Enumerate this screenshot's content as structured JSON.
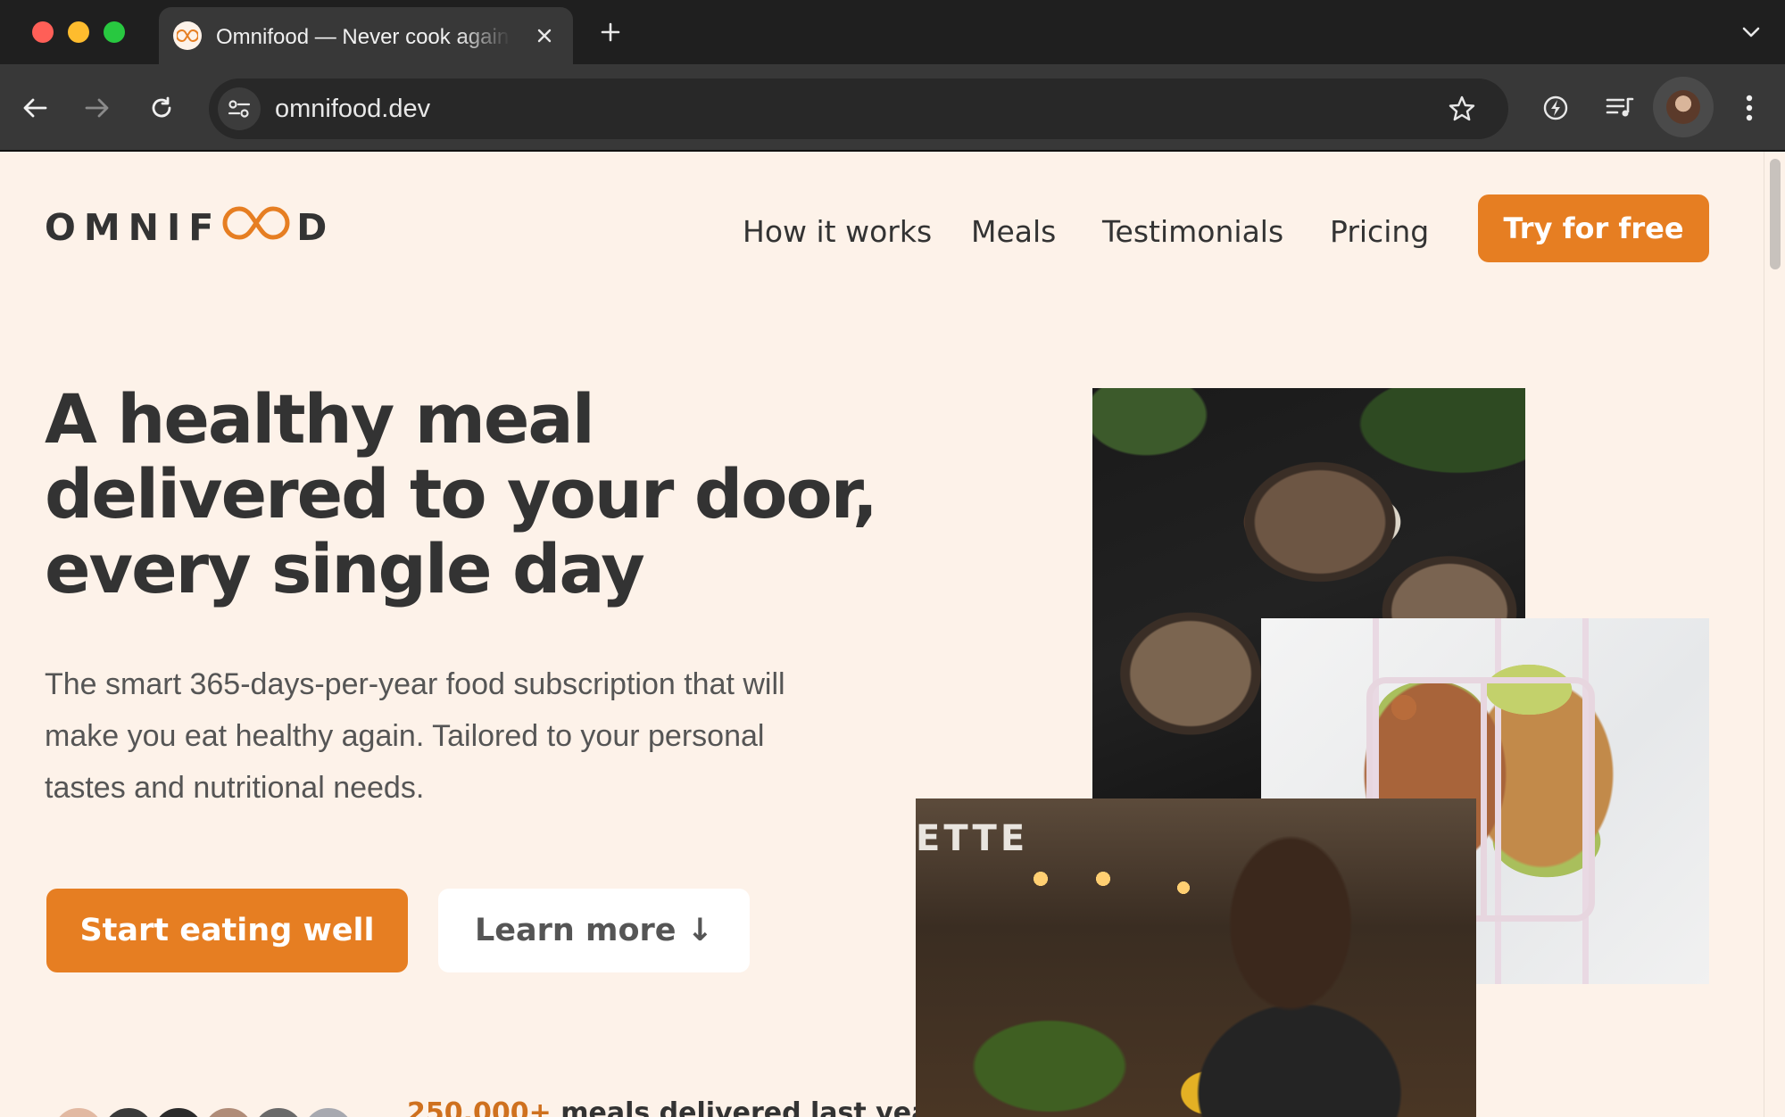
{
  "browser": {
    "tab": {
      "title": "Omnifood — Never cook again!"
    },
    "url": "omnifood.dev"
  },
  "site": {
    "logo_text": {
      "left": "OMNIF",
      "right": "D"
    },
    "nav": {
      "items": [
        {
          "label": "How it works"
        },
        {
          "label": "Meals"
        },
        {
          "label": "Testimonials"
        },
        {
          "label": "Pricing"
        }
      ],
      "cta_label": "Try for free"
    },
    "hero": {
      "headline": "A healthy meal delivered to your door, every single day",
      "subtext": "The smart 365-days-per-year food subscription that will make you eat healthy again. Tailored to your personal tastes and nutritional needs.",
      "primary_button": "Start eating well",
      "secondary_button": "Learn more ↓",
      "delivered_number": "250,000+",
      "delivered_text": " meals delivered last year!",
      "image_sign_text": "ETTE"
    }
  },
  "colors": {
    "brand": "#e67e22",
    "page_bg": "#fdf2e9",
    "text_dark": "#333333"
  }
}
